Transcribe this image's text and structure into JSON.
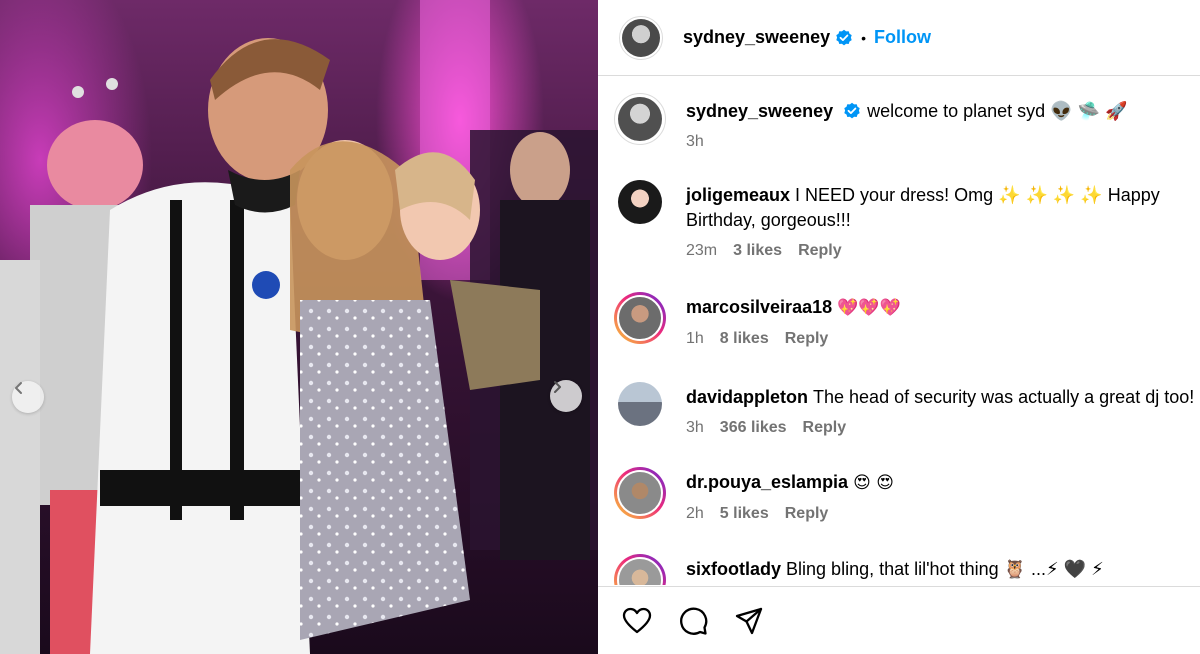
{
  "post": {
    "author": "sydney_sweeney",
    "follow_label": "Follow",
    "separator": "•",
    "caption": {
      "username": "sydney_sweeney",
      "text": "welcome to planet syd 👽 🛸 🚀",
      "time": "3h"
    }
  },
  "comments": [
    {
      "username": "joligemeaux",
      "text": "I NEED your dress! Omg ✨ ✨ ✨ ✨ Happy Birthday, gorgeous!!!",
      "time": "23m",
      "likes": "3 likes",
      "reply": "Reply",
      "avatar_style": "plain"
    },
    {
      "username": "marcosilveiraa18",
      "text": "💖💖💖",
      "time": "1h",
      "likes": "8 likes",
      "reply": "Reply",
      "avatar_style": "story"
    },
    {
      "username": "davidappleton",
      "text": "The head of security was actually a great dj too!",
      "time": "3h",
      "likes": "366 likes",
      "reply": "Reply",
      "avatar_style": "plain"
    },
    {
      "username": "dr.pouya_eslampia",
      "text": "😍 😍",
      "time": "2h",
      "likes": "5 likes",
      "reply": "Reply",
      "avatar_style": "story"
    },
    {
      "username": "sixfootlady",
      "text": "Bling bling, that lil'hot thing 🦉 ...⚡ 🖤 ⚡",
      "time": "",
      "likes": "",
      "reply": "",
      "avatar_style": "story"
    }
  ],
  "icons": {
    "verified": "verified-badge-icon",
    "like": "heart-icon",
    "comment": "comment-icon",
    "share": "share-icon",
    "prev": "chevron-left-icon",
    "next": "chevron-right-icon"
  },
  "colors": {
    "follow": "#0095f6",
    "meta_gray": "#737373",
    "divider": "#dbdbdb",
    "verified_blue": "#0095f6"
  }
}
